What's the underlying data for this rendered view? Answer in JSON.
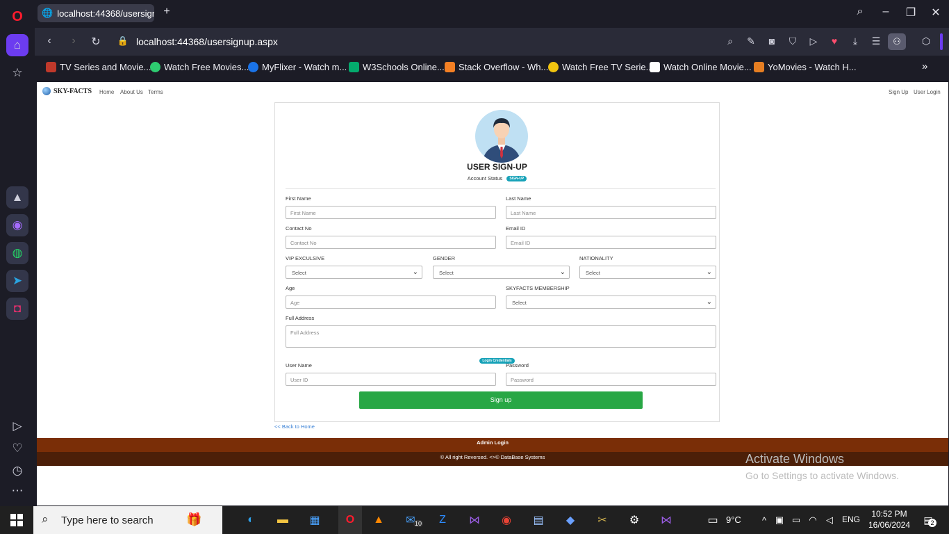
{
  "browser": {
    "tab_title": "localhost:44368/usersignu",
    "address": "localhost:44368/usersignup.aspx",
    "bookmarks": [
      {
        "label": "TV Series and Movie...",
        "color": "#c0392b"
      },
      {
        "label": "Watch Free Movies...",
        "color": "#2ecc71"
      },
      {
        "label": "MyFlixer - Watch m...",
        "color": "#1a73e8"
      },
      {
        "label": "W3Schools Online...",
        "color": "#04aa6d"
      },
      {
        "label": "Stack Overflow - Wh...",
        "color": "#f48024"
      },
      {
        "label": "Watch Free TV Serie...",
        "color": "#f1c40f"
      },
      {
        "label": "Watch Online Movie...",
        "color": "#ffffff"
      },
      {
        "label": "YoMovies - Watch H...",
        "color": "#e67e22"
      }
    ]
  },
  "site": {
    "brand": "SKY-FACTS",
    "nav": [
      "Home",
      "About Us",
      "Terms"
    ],
    "nav_right": [
      "Sign Up",
      "User Login"
    ]
  },
  "form": {
    "title": "USER SIGN-UP",
    "status_label": "Account Status",
    "status_badge": "SIGN-UP",
    "first_name_label": "First Name",
    "first_name_placeholder": "First Name",
    "last_name_label": "Last Name",
    "last_name_placeholder": "Last Name",
    "contact_label": "Contact No",
    "contact_placeholder": "Contact No",
    "email_label": "Email ID",
    "email_placeholder": "Email ID",
    "vip_label": "VIP EXCULSIVE",
    "vip_value": "Select",
    "gender_label": "GENDER",
    "gender_value": "Select",
    "nationality_label": "NATIONALITY",
    "nationality_value": "Select",
    "age_label": "Age",
    "age_placeholder": "Age",
    "membership_label": "SKYFACTS MEMBERSHIP",
    "membership_value": "Select",
    "address_label": "Full Address",
    "address_placeholder": "Full Address",
    "credentials_badge": "Login Credentials",
    "username_label": "User Name",
    "username_placeholder": "User ID",
    "password_label": "Password",
    "password_placeholder": "Password",
    "signup_button": "Sign up"
  },
  "links": {
    "back_home": "<< Back to Home"
  },
  "footer": {
    "admin": "Admin Login",
    "copyright": "© All right Reversed. <>© DataBase Systems"
  },
  "watermark": {
    "line1": "Activate Windows",
    "line2": "Go to Settings to activate Windows."
  },
  "taskbar": {
    "search_placeholder": "Type here to search",
    "weather": "9°C",
    "language": "ENG",
    "time": "10:52 PM",
    "date": "16/06/2024",
    "mail_badge": "10",
    "notif_count": "2"
  }
}
